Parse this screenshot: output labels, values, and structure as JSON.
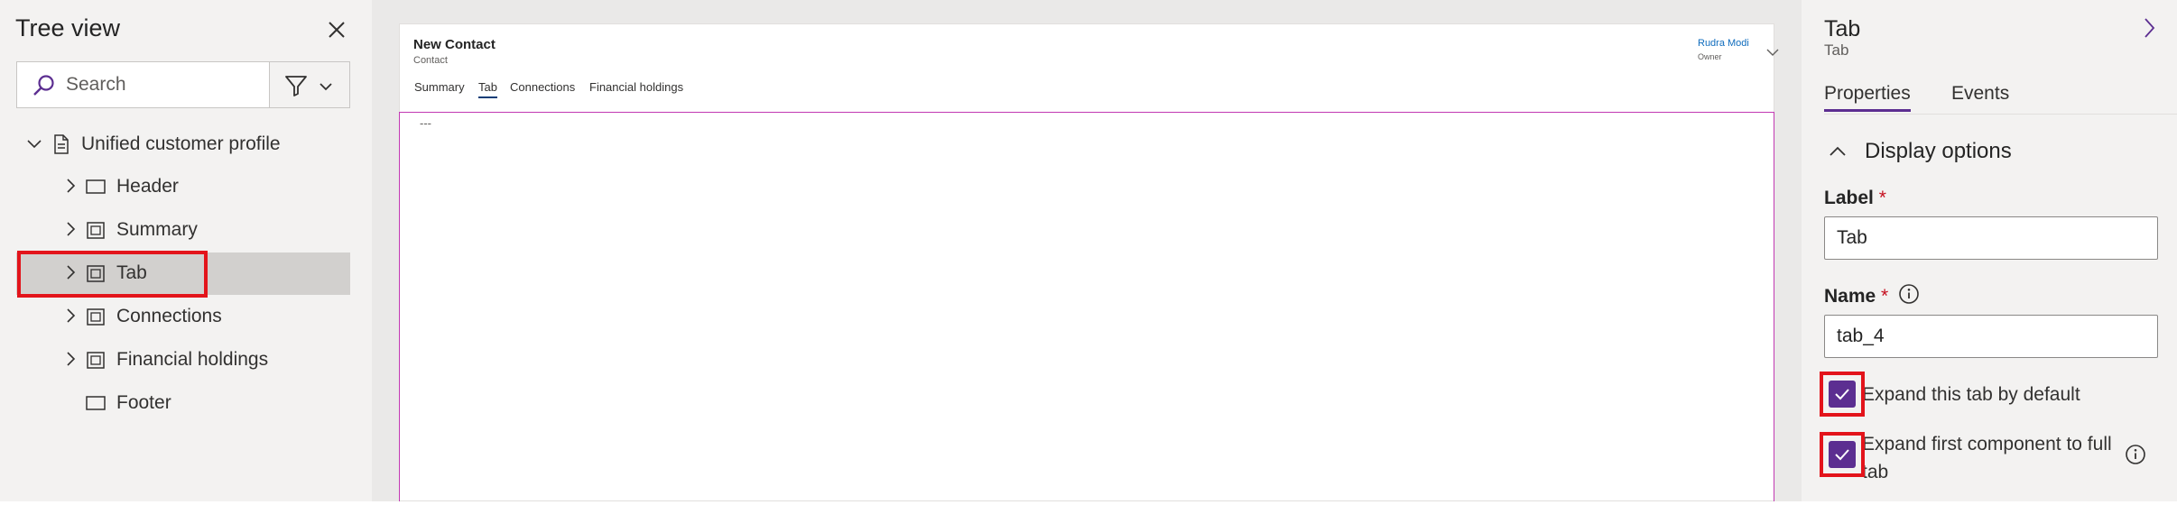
{
  "tree": {
    "title": "Tree view",
    "search_placeholder": "Search",
    "root": {
      "label": "Unified customer profile",
      "icon": "document-icon"
    },
    "items": [
      {
        "label": "Header",
        "icon": "rectangle-icon",
        "has_children": true
      },
      {
        "label": "Summary",
        "icon": "tab-icon",
        "has_children": true
      },
      {
        "label": "Tab",
        "icon": "tab-icon",
        "has_children": true,
        "selected": true
      },
      {
        "label": "Connections",
        "icon": "tab-icon",
        "has_children": true
      },
      {
        "label": "Financial holdings",
        "icon": "tab-icon",
        "has_children": true
      },
      {
        "label": "Footer",
        "icon": "rectangle-icon",
        "has_children": false
      }
    ]
  },
  "form": {
    "title": "New Contact",
    "subtitle": "Contact",
    "owner_name": "Rudra Modi",
    "owner_role": "Owner",
    "tabs": [
      "Summary",
      "Tab",
      "Connections",
      "Financial holdings"
    ],
    "active_tab": "Tab",
    "body_placeholder": "---"
  },
  "props": {
    "title": "Tab",
    "subtitle": "Tab",
    "tabs": [
      "Properties",
      "Events"
    ],
    "active_tab": "Properties",
    "section": "Display options",
    "label_field": {
      "label": "Label",
      "required_mark": "*",
      "value": "Tab"
    },
    "name_field": {
      "label": "Name",
      "required_mark": "*",
      "value": "tab_4"
    },
    "checkbox_expand": {
      "label": "Expand this tab by default",
      "checked": true
    },
    "checkbox_full": {
      "label": "Expand first component to full tab",
      "checked": true
    }
  },
  "colors": {
    "accent": "#5c2e91",
    "highlight": "#e3141b",
    "selected_row": "#d2d0ce",
    "tab_border": "#c239b3",
    "owner_link": "#0f6cbd"
  }
}
